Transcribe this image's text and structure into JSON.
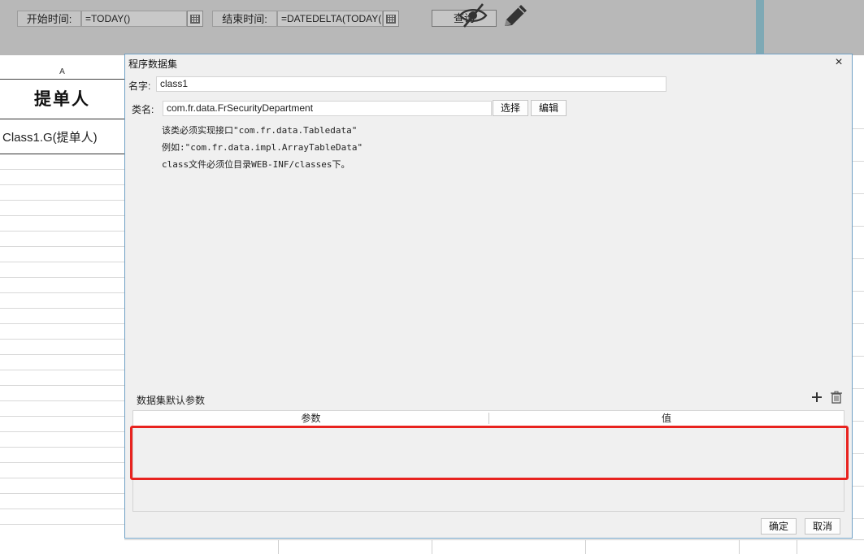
{
  "toolbar": {
    "start_label": "开始时间:",
    "start_value": "=TODAY()",
    "end_label": "结束时间:",
    "end_value": "=DATEDELTA(TODAY(",
    "query_label": "查询"
  },
  "sheet": {
    "column_a": "A",
    "title_cell": "提单人",
    "class_cell": "Class1.G(提单人)"
  },
  "dialog": {
    "title": "程序数据集",
    "close_label": "×",
    "name_label": "名字:",
    "name_value": "class1",
    "class_label": "类名:",
    "class_value": "com.fr.data.FrSecurityDepartment",
    "choose_button": "选择",
    "edit_button": "编辑",
    "desc_line1": "该类必须实现接口\"com.fr.data.Tabledata\"",
    "desc_line2": "例如:\"com.fr.data.impl.ArrayTableData\"",
    "desc_line3": "class文件必须位目录WEB-INF/classes下。",
    "params_title": "数据集默认参数",
    "col_param": "参数",
    "col_value": "值",
    "ok_button": "确定",
    "cancel_button": "取消"
  },
  "colors": {
    "highlight": "#e8231f",
    "dialog_border": "#6fa0c4",
    "toolbar_bg": "#b8b8b8"
  }
}
